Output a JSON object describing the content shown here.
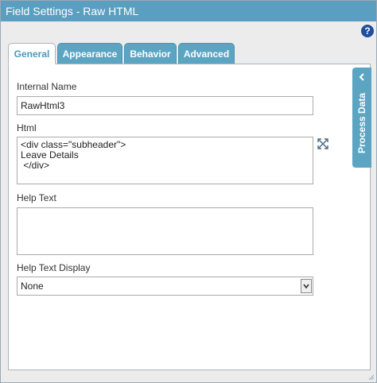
{
  "window": {
    "title": "Field Settings - Raw HTML"
  },
  "help": {
    "icon": "help-icon",
    "glyph": "?"
  },
  "tabs": [
    {
      "label": "General",
      "active": true
    },
    {
      "label": "Appearance",
      "active": false
    },
    {
      "label": "Behavior",
      "active": false
    },
    {
      "label": "Advanced",
      "active": false
    }
  ],
  "form": {
    "internal_name": {
      "label": "Internal Name",
      "value": "RawHtml3"
    },
    "html": {
      "label": "Html",
      "value": "<div class=\"subheader\">\nLeave Details\n </div>"
    },
    "help_text": {
      "label": "Help Text",
      "value": ""
    },
    "help_text_display": {
      "label": "Help Text Display",
      "selected": "None"
    }
  },
  "side_panel": {
    "label": "Process Data",
    "icon": "chevron-left-icon"
  },
  "colors": {
    "titlebar": "#5a9ec0",
    "tab_inactive": "#5ba5c3",
    "tab_active_text": "#4a98bf",
    "help_icon": "#1f4e9c"
  }
}
